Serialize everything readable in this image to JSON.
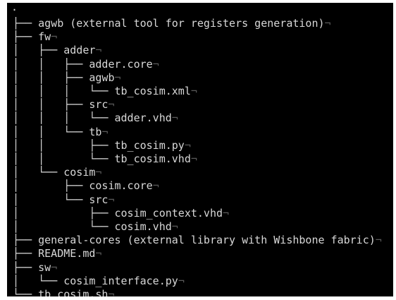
{
  "root": ".",
  "end_of_line_mark": "¬",
  "tree": [
    {
      "guide": "├── ",
      "name": "agwb (external tool for registers generation)",
      "kind": "dir"
    },
    {
      "guide": "├── ",
      "name": "fw",
      "kind": "dir"
    },
    {
      "guide": "│   ├── ",
      "name": "adder",
      "kind": "dir"
    },
    {
      "guide": "│   │   ├── ",
      "name": "adder.core",
      "kind": "file"
    },
    {
      "guide": "│   │   ├── ",
      "name": "agwb",
      "kind": "dir"
    },
    {
      "guide": "│   │   │   └── ",
      "name": "tb_cosim.xml",
      "kind": "file"
    },
    {
      "guide": "│   │   ├── ",
      "name": "src",
      "kind": "dir"
    },
    {
      "guide": "│   │   │   └── ",
      "name": "adder.vhd",
      "kind": "file"
    },
    {
      "guide": "│   │   └── ",
      "name": "tb",
      "kind": "dir"
    },
    {
      "guide": "│   │       ├── ",
      "name": "tb_cosim.py",
      "kind": "file"
    },
    {
      "guide": "│   │       └── ",
      "name": "tb_cosim.vhd",
      "kind": "file"
    },
    {
      "guide": "│   └── ",
      "name": "cosim",
      "kind": "dir"
    },
    {
      "guide": "│       ├── ",
      "name": "cosim.core",
      "kind": "file"
    },
    {
      "guide": "│       └── ",
      "name": "src",
      "kind": "dir"
    },
    {
      "guide": "│           ├── ",
      "name": "cosim_context.vhd",
      "kind": "file"
    },
    {
      "guide": "│           └── ",
      "name": "cosim.vhd",
      "kind": "file"
    },
    {
      "guide": "├── ",
      "name": "general-cores (external library with Wishbone fabric)",
      "kind": "dir"
    },
    {
      "guide": "├── ",
      "name": "README.md",
      "kind": "file"
    },
    {
      "guide": "├── ",
      "name": "sw",
      "kind": "dir"
    },
    {
      "guide": "│   └── ",
      "name": "cosim_interface.py",
      "kind": "file"
    },
    {
      "guide": "└── ",
      "name": "tb_cosim.sh",
      "kind": "file"
    }
  ]
}
